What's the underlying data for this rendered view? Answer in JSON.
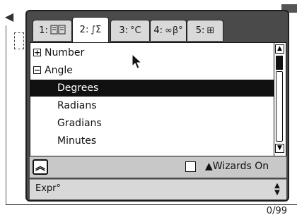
{
  "document": {
    "counter": "0/99"
  },
  "catalog": {
    "tabs": [
      {
        "label": "1:",
        "icon": "book-icon"
      },
      {
        "label": "2:",
        "icon": "integral-sum-icon",
        "icon_text": "∫Σ"
      },
      {
        "label": "3:",
        "icon": "units-icon",
        "icon_text": "°C"
      },
      {
        "label": "4:",
        "icon": "symbols-icon",
        "icon_text": "∞β°"
      },
      {
        "label": "5:",
        "icon": "templates-icon",
        "icon_text": "⊞"
      }
    ],
    "active_tab": 1,
    "list": [
      {
        "label": "Number",
        "expander": "+",
        "indent": 0
      },
      {
        "label": "Angle",
        "expander": "−",
        "indent": 0
      },
      {
        "label": "Degrees",
        "indent": 1,
        "selected": true
      },
      {
        "label": "Radians",
        "indent": 1
      },
      {
        "label": "Gradians",
        "indent": 1
      },
      {
        "label": "Minutes",
        "indent": 1
      }
    ],
    "wizards_label": "▲Wizards On",
    "wizards_checked": false,
    "expr_label": "Expr°"
  }
}
